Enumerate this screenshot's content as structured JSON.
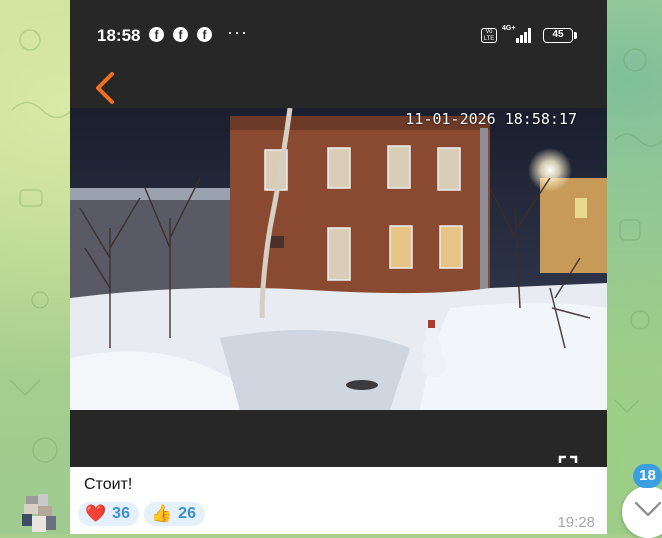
{
  "phone_status": {
    "time": "18:58",
    "notification_icons": [
      "facebook-icon",
      "facebook-icon",
      "facebook-icon"
    ],
    "more_indicator": "···",
    "volte": "Vo LTE",
    "network": "4G+",
    "battery": "45"
  },
  "camera": {
    "timestamp": "11-01-2026 18:58:17"
  },
  "message": {
    "caption": "Стоит!",
    "time": "19:28",
    "reactions": [
      {
        "emoji": "❤️",
        "count": "36"
      },
      {
        "emoji": "👍",
        "count": "26"
      }
    ]
  },
  "scroll": {
    "unread_count": "18"
  },
  "colors": {
    "accent": "#3a9ee0",
    "back_arrow": "#f07020",
    "reaction_bg": "#e4f1fb",
    "reaction_text": "#3a8fcc"
  }
}
